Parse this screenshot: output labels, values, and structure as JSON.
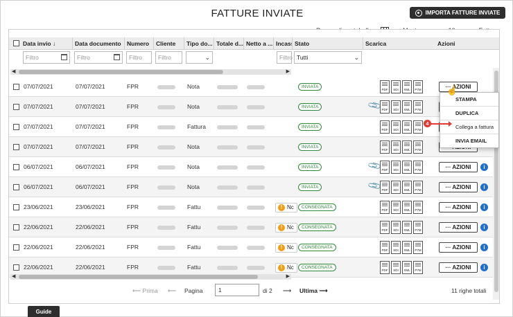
{
  "page": {
    "title": "FATTURE INVIATE",
    "import_label": "IMPORTA FATTURE INVIATE",
    "guide_label": "Guide"
  },
  "toolbar": {
    "customize_label": "Personalizza tabella",
    "show_label": "Mostra",
    "page_size": "10",
    "invoices_label": "Fatture"
  },
  "columns": [
    "Data invio",
    "Data documento",
    "Numero",
    "Cliente",
    "Tipo do...",
    "Totale d...",
    "Netto a ...",
    "Incass",
    "Stato",
    "Scarica",
    "Azioni"
  ],
  "sort_indicator": "↓",
  "filters": {
    "placeholder": "Filtro",
    "stato_value": "Tutti"
  },
  "rows": [
    {
      "data_invio": "07/07/2021",
      "data_doc": "07/07/2021",
      "numero": "FPR",
      "tipo": "Nota",
      "stato": "INVIATA",
      "warn": false,
      "clip": false,
      "info": false
    },
    {
      "data_invio": "07/07/2021",
      "data_doc": "07/07/2021",
      "numero": "FPR",
      "tipo": "Nota",
      "stato": "INVIATA",
      "warn": false,
      "clip": true,
      "info": false
    },
    {
      "data_invio": "07/07/2021",
      "data_doc": "07/07/2021",
      "numero": "FPR",
      "tipo": "Fattura",
      "stato": "INVIATA",
      "warn": false,
      "clip": false,
      "info": false
    },
    {
      "data_invio": "07/07/2021",
      "data_doc": "07/07/2021",
      "numero": "FPR",
      "tipo": "Nota",
      "stato": "INVIATA",
      "warn": false,
      "clip": false,
      "info": false
    },
    {
      "data_invio": "06/07/2021",
      "data_doc": "06/07/2021",
      "numero": "FPR",
      "tipo": "Nota",
      "stato": "INVIATA",
      "warn": false,
      "clip": true,
      "info": true
    },
    {
      "data_invio": "06/07/2021",
      "data_doc": "06/07/2021",
      "numero": "FPR",
      "tipo": "Nota",
      "stato": "INVIATA",
      "warn": false,
      "clip": true,
      "info": true
    },
    {
      "data_invio": "23/06/2021",
      "data_doc": "23/06/2021",
      "numero": "FPR",
      "tipo": "Fattu",
      "stato": "CONSEGNATA",
      "warn": true,
      "clip": false,
      "info": true
    },
    {
      "data_invio": "22/06/2021",
      "data_doc": "22/06/2021",
      "numero": "FPR",
      "tipo": "Fattu",
      "stato": "CONSEGNATA",
      "warn": true,
      "clip": false,
      "info": true
    },
    {
      "data_invio": "22/06/2021",
      "data_doc": "22/06/2021",
      "numero": "FPR",
      "tipo": "Fattu",
      "stato": "CONSEGNATA",
      "warn": true,
      "clip": false,
      "info": true
    },
    {
      "data_invio": "22/06/2021",
      "data_doc": "22/06/2021",
      "numero": "FPR",
      "tipo": "Fattu",
      "stato": "CONSEGNATA",
      "warn": true,
      "clip": false,
      "info": true
    }
  ],
  "warn_text": "Nc",
  "downloads": [
    "PDF",
    "SDI",
    "XML",
    "P7M"
  ],
  "actions_label": "··· AZIONI",
  "menu": [
    "STAMPA",
    "DUPLICA",
    "Collega a fattura",
    "INVIA EMAIL"
  ],
  "step_number": "4",
  "pager": {
    "first": "⟵ Prima",
    "prev": "⟵",
    "page_label": "Pagina",
    "page_value": "1",
    "of": "di 2",
    "next": "⟶",
    "last": "Ultima ⟶",
    "total": "11 righe totali"
  },
  "colors": {
    "dark": "#2e2e2e",
    "green": "#2f8a3d",
    "orange": "#f39c12",
    "blue": "#1f6fd1",
    "red": "#e53935"
  }
}
